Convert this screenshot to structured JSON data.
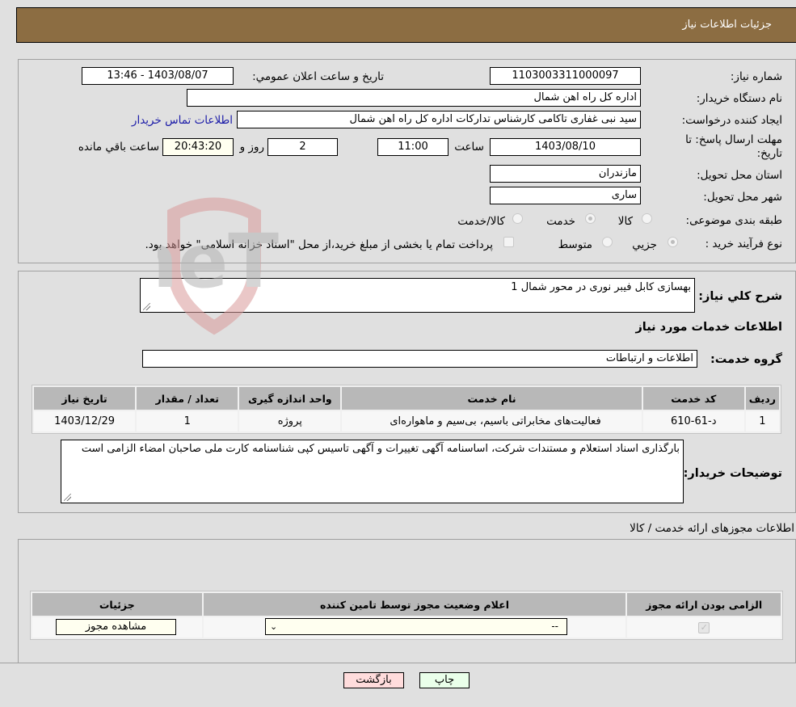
{
  "header": {
    "title": "جزئيات اطلاعات نیاز"
  },
  "form": {
    "need_number": {
      "label": "شماره نیاز:",
      "value": "1103003311000097"
    },
    "announce_datetime": {
      "label": "تاریخ و ساعت اعلان عمومي:",
      "value": "1403/08/07 - 13:46"
    },
    "buyer_org": {
      "label": "نام دستگاه خریدار:",
      "value": "اداره کل راه اهن شمال"
    },
    "requester": {
      "label": "ایجاد کننده درخواست:",
      "value": "سید نبی غفاری تاکامی کارشناس تدارکات اداره کل راه اهن شمال"
    },
    "buyer_contact_link": "اطلاعات تماس خریدار",
    "deadline": {
      "label": "مهلت ارسال پاسخ: تا تاریخ:",
      "date": "1403/08/10",
      "time_label": "ساعت",
      "time": "11:00",
      "days": "2",
      "days_label": "روز و",
      "remaining": "20:43:20",
      "remaining_label": "ساعت باقي مانده"
    },
    "province": {
      "label": "استان محل تحویل:",
      "value": "مازندران"
    },
    "city": {
      "label": "شهر محل تحویل:",
      "value": "ساری"
    },
    "category": {
      "label": "طبقه بندی موضوعی:",
      "options": [
        "کالا",
        "خدمت",
        "کالا/خدمت"
      ],
      "selected": "خدمت"
    },
    "purchase_type": {
      "label": "نوع فرآیند خرید :",
      "options": [
        "جزیي",
        "متوسط"
      ],
      "selected": "جزیي",
      "treasury_note": "پرداخت تمام یا بخشی از مبلغ خرید،از محل \"اسناد خزانه اسلامی\" خواهد بود."
    }
  },
  "description": {
    "label": "شرح کلي نیاز:",
    "value": "بهسازی کابل فیبر نوری در محور شمال 1"
  },
  "services": {
    "section_title": "اطلاعات خدمات مورد نیاز",
    "group_label": "گروه خدمت:",
    "group_value": "اطلاعات و ارتباطات",
    "columns": [
      "ردیف",
      "کد خدمت",
      "نام خدمت",
      "واحد اندازه گیری",
      "تعداد / مقدار",
      "تاریخ نیاز"
    ],
    "rows": [
      [
        "1",
        "د-61-610",
        "فعالیت‌های مخابراتی باسیم، بی‌سیم و ماهواره‌ای",
        "پروژه",
        "1",
        "1403/12/29"
      ]
    ]
  },
  "buyer_notes": {
    "label": "توضیحات خریدار:",
    "value": "بارگذاری اسناد استعلام و مستندات شرکت، اساسنامه آگهی تغییرات و آگهی تاسیس کپی شناسنامه کارت ملی صاحبان امضاء الزامی است"
  },
  "permits": {
    "section_title": "اطلاعات مجوزهای ارائه خدمت / کالا",
    "columns": [
      "الزامی بودن ارائه مجوز",
      "اعلام وضعیت مجوز توسط تامین کننده",
      "جزئیات"
    ],
    "row": {
      "required_checked": true,
      "status_value": "--",
      "details_button": "مشاهده مجوز"
    }
  },
  "buttons": {
    "print": "چاپ",
    "back": "بازگشت"
  },
  "colors": {
    "header_bg": "#8c6d42",
    "print_bg": "#eaffea",
    "back_bg": "#ffdcdc",
    "link": "#1a1aa8"
  },
  "watermark": "AriaTender.neT"
}
